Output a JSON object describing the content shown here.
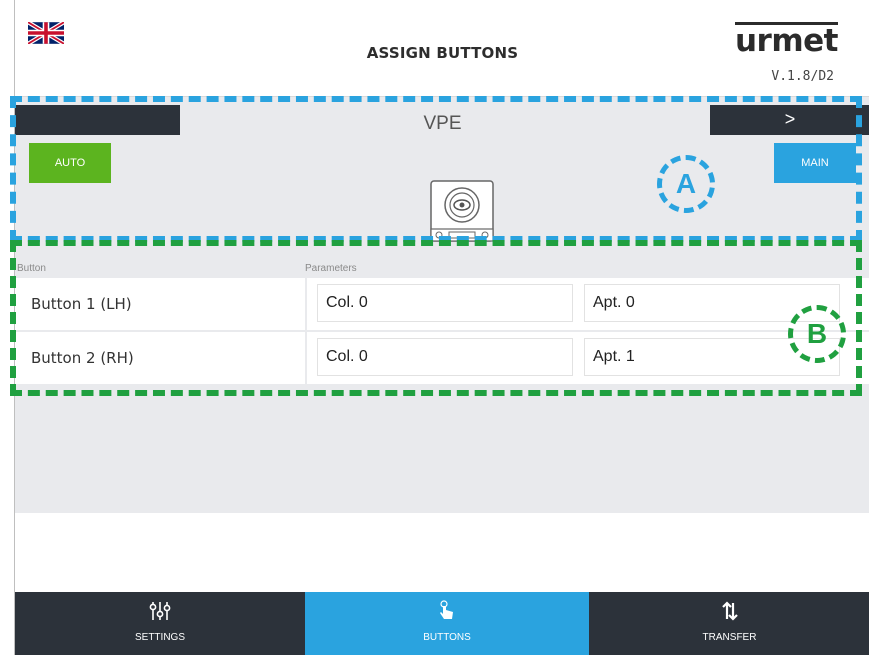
{
  "header": {
    "title": "ASSIGN BUTTONS",
    "logo": "urmet",
    "version": "V.1.8/D2",
    "flag_icon": "uk-flag-icon"
  },
  "panel": {
    "title": "VPE",
    "next_label": ">",
    "auto_label": "AUTO",
    "main_label": "MAIN",
    "device_icon": "camera-device-icon"
  },
  "annotations": {
    "a": "A",
    "b": "B"
  },
  "table": {
    "headers": {
      "button": "Button",
      "parameters": "Parameters"
    },
    "rows": [
      {
        "label": "Button 1 (LH)",
        "col": "Col. 0",
        "apt": "Apt. 0"
      },
      {
        "label": "Button 2 (RH)",
        "col": "Col. 0",
        "apt": "Apt. 1"
      }
    ]
  },
  "bottom_nav": {
    "tabs": [
      {
        "label": "SETTINGS",
        "icon": "sliders-icon"
      },
      {
        "label": "BUTTONS",
        "icon": "tap-hand-icon"
      },
      {
        "label": "TRANSFER",
        "icon": "transfer-arrows-icon"
      }
    ]
  },
  "colors": {
    "green": "#5cb41f",
    "blue": "#2aa3df",
    "dark": "#2c323a"
  }
}
